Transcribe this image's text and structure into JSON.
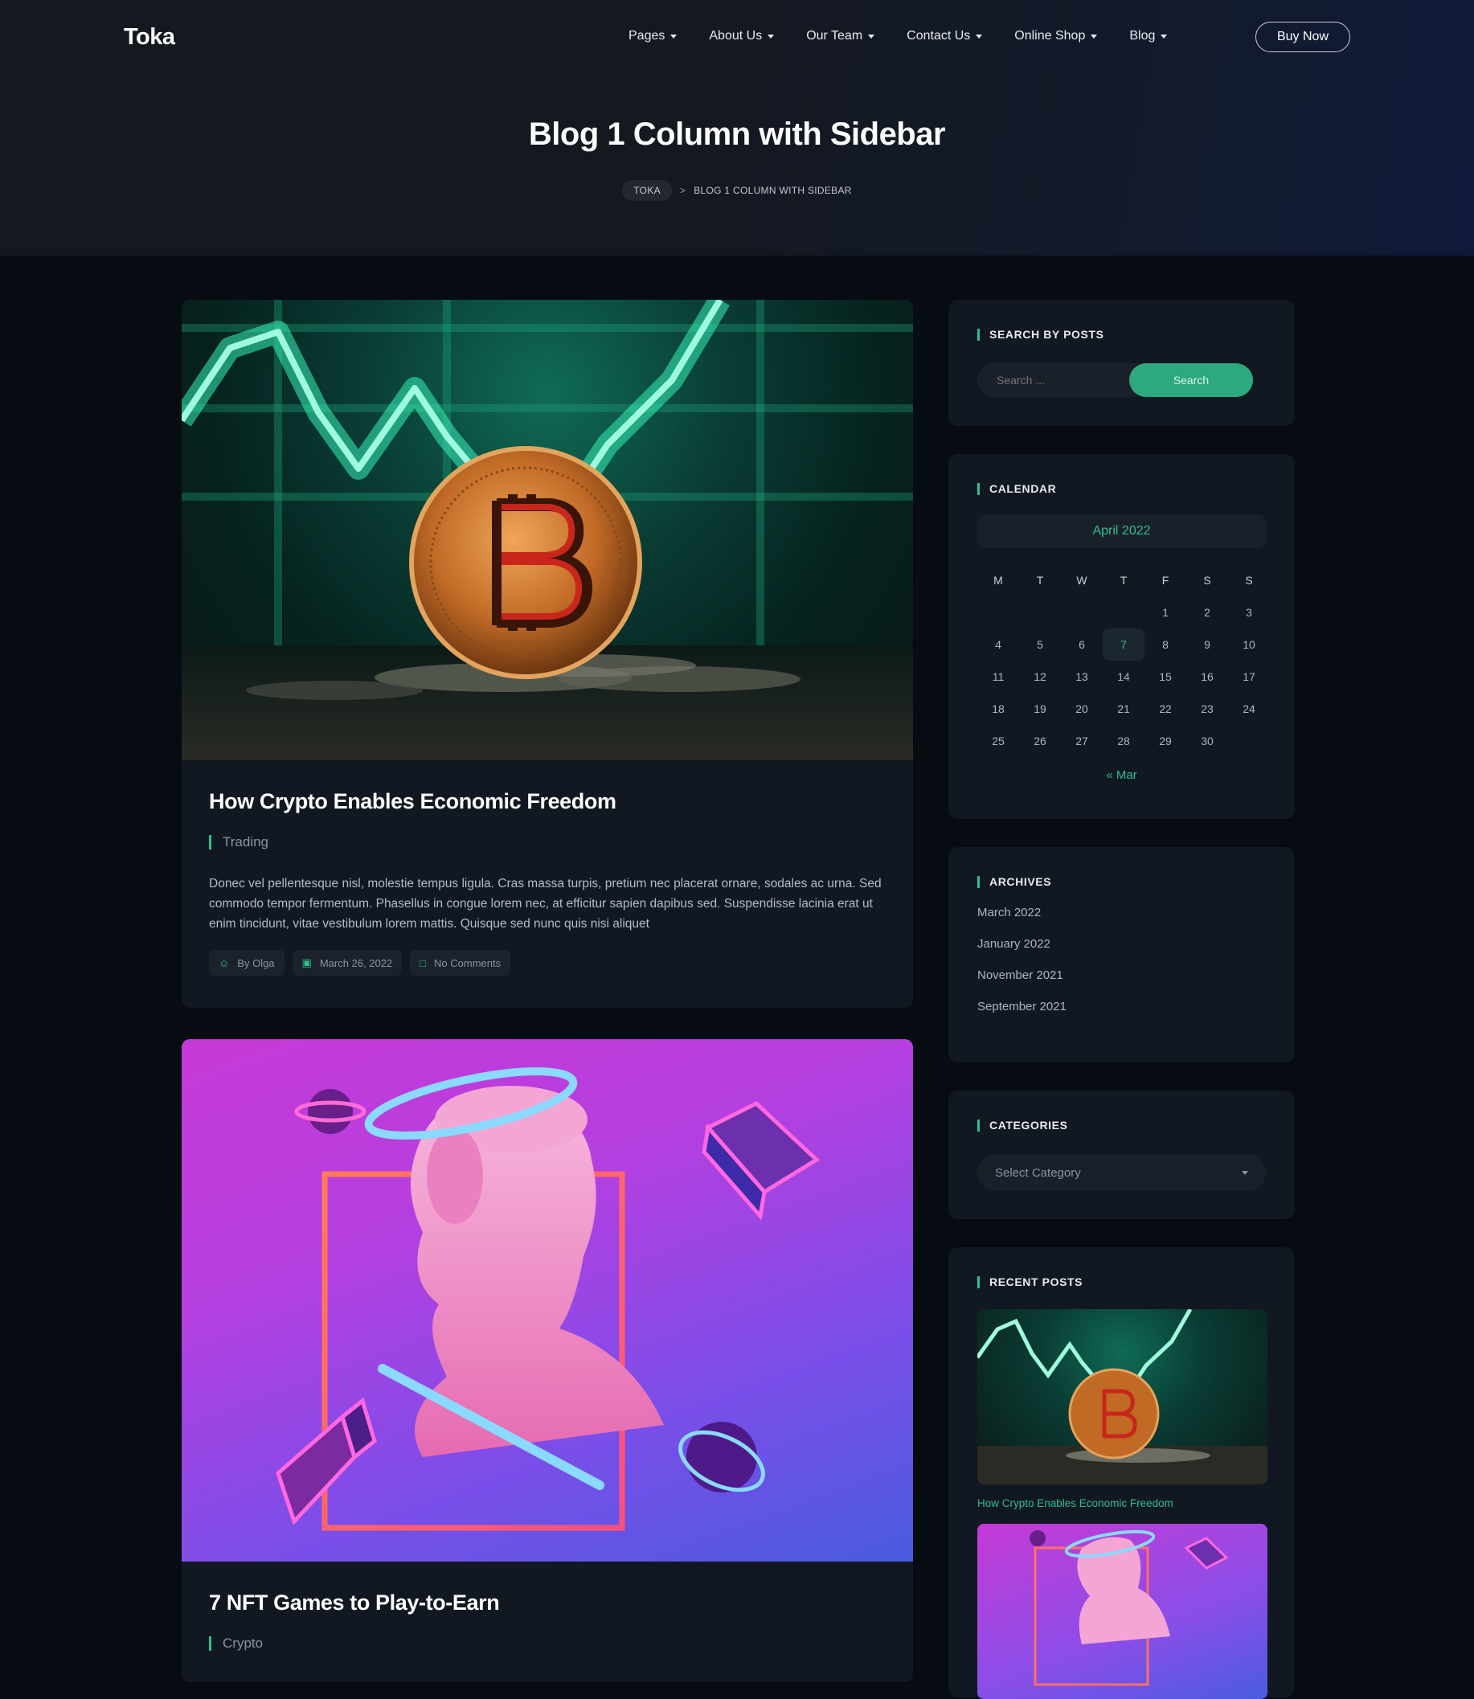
{
  "header": {
    "logo": "Toka",
    "nav": [
      {
        "label": "Pages"
      },
      {
        "label": "About Us"
      },
      {
        "label": "Our Team"
      },
      {
        "label": "Contact Us"
      },
      {
        "label": "Online Shop"
      },
      {
        "label": "Blog"
      }
    ],
    "buy_label": "Buy Now",
    "page_title": "Blog 1 Column with Sidebar",
    "breadcrumb": {
      "home": "TOKA",
      "separator": ">",
      "current": "BLOG 1 COLUMN WITH SIDEBAR"
    }
  },
  "posts": [
    {
      "title": "How Crypto Enables Economic Freedom",
      "category": "Trading",
      "excerpt": "Donec vel pellentesque nisl, molestie tempus ligula. Cras massa turpis, pretium nec placerat ornare, sodales ac urna. Sed commodo tempor fermentum. Phasellus in congue lorem nec, at efficitur sapien dapibus sed. Suspendisse lacinia erat ut enim tincidunt, vitae vestibulum lorem mattis. Quisque sed nunc quis nisi aliquet",
      "author": "By Olga",
      "date": "March 26, 2022",
      "comments": "No Comments"
    },
    {
      "title": "7 NFT Games to Play-to-Earn",
      "category": "Crypto"
    }
  ],
  "sidebar": {
    "search": {
      "title": "SEARCH BY POSTS",
      "placeholder": "Search ...",
      "button": "Search"
    },
    "calendar": {
      "title": "CALENDAR",
      "month": "April 2022",
      "days_of_week": [
        "M",
        "T",
        "W",
        "T",
        "F",
        "S",
        "S"
      ],
      "weeks": [
        [
          "",
          "",
          "",
          "",
          "1",
          "2",
          "3"
        ],
        [
          "4",
          "5",
          "6",
          "7",
          "8",
          "9",
          "10"
        ],
        [
          "11",
          "12",
          "13",
          "14",
          "15",
          "16",
          "17"
        ],
        [
          "18",
          "19",
          "20",
          "21",
          "22",
          "23",
          "24"
        ],
        [
          "25",
          "26",
          "27",
          "28",
          "29",
          "30",
          ""
        ]
      ],
      "today": "7",
      "prev_link": "« Mar"
    },
    "archives": {
      "title": "ARCHIVES",
      "items": [
        "March 2022",
        "January 2022",
        "November 2021",
        "September 2021"
      ]
    },
    "categories": {
      "title": "CATEGORIES",
      "selected": "Select Category"
    },
    "recent": {
      "title": "RECENT POSTS",
      "items": [
        "How Crypto Enables Economic Freedom"
      ]
    }
  },
  "colors": {
    "accent": "#2fbf8f",
    "background": "#070b12",
    "card": "#121821"
  }
}
